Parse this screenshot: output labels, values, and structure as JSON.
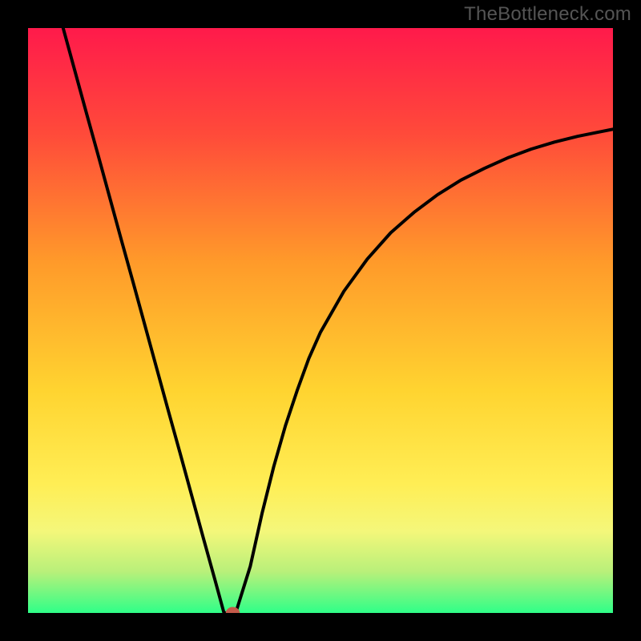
{
  "watermark": "TheBottleneck.com",
  "chart_data": {
    "type": "line",
    "title": "",
    "xlabel": "",
    "ylabel": "",
    "xlim": [
      0,
      100
    ],
    "ylim": [
      0,
      100
    ],
    "grid": false,
    "legend": null,
    "background_gradient_stops": [
      {
        "pct": 0,
        "color": "#ff1a4b"
      },
      {
        "pct": 18,
        "color": "#ff4a3a"
      },
      {
        "pct": 40,
        "color": "#ff9a2a"
      },
      {
        "pct": 62,
        "color": "#ffd430"
      },
      {
        "pct": 78,
        "color": "#ffee55"
      },
      {
        "pct": 86,
        "color": "#f4f77a"
      },
      {
        "pct": 93,
        "color": "#b8f07a"
      },
      {
        "pct": 100,
        "color": "#2fff88"
      }
    ],
    "series": [
      {
        "name": "descending-curve",
        "x": [
          6,
          8,
          10,
          12,
          14,
          16,
          18,
          20,
          22,
          24,
          26,
          28,
          30,
          32,
          33.5
        ],
        "y": [
          100,
          92.7,
          85.4,
          78.2,
          70.9,
          63.6,
          56.4,
          49.1,
          41.8,
          34.5,
          27.3,
          20.0,
          12.7,
          5.5,
          0.0
        ]
      },
      {
        "name": "minimum-flat",
        "x": [
          33.5,
          35.5
        ],
        "y": [
          0.0,
          0.0
        ]
      },
      {
        "name": "ascending-curve",
        "x": [
          35.5,
          38,
          40,
          42,
          44,
          46,
          48,
          50,
          54,
          58,
          62,
          66,
          70,
          74,
          78,
          82,
          86,
          90,
          94,
          98,
          100
        ],
        "y": [
          0.0,
          8,
          17,
          25,
          32,
          38,
          43.5,
          48,
          55,
          60.5,
          65,
          68.5,
          71.5,
          74,
          76,
          77.8,
          79.3,
          80.5,
          81.5,
          82.3,
          82.7
        ]
      }
    ],
    "markers": [
      {
        "name": "min-point",
        "x": 35,
        "y": 0.0,
        "color": "#c45a4a",
        "r": 1.2
      }
    ]
  }
}
